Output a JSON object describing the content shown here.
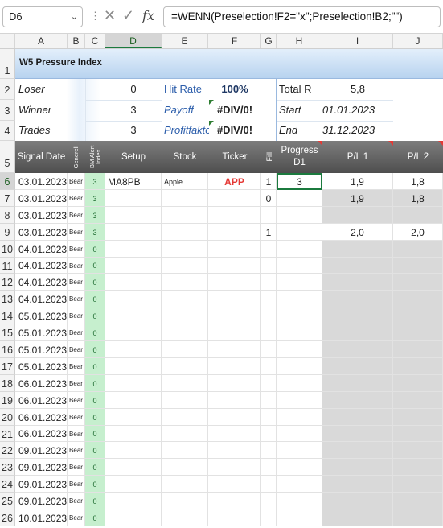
{
  "formula_bar": {
    "name_box": "D6",
    "cancel_icon": "✕",
    "enter_icon": "✓",
    "fx_label": "fx",
    "formula": "=WENN(Preselection!F2=\"x\";Preselection!B2;\"\")"
  },
  "columns": [
    "A",
    "B",
    "C",
    "D",
    "E",
    "F",
    "G",
    "H",
    "I",
    "J"
  ],
  "title": "W5 Pressure Index",
  "stats": {
    "loser_label": "Loser",
    "loser_value": "0",
    "winner_label": "Winner",
    "winner_value": "3",
    "trades_label": "Trades",
    "trades_value": "3",
    "hitrate_label": "Hit Rate",
    "hitrate_value": "100%",
    "payoff_label": "Payoff",
    "payoff_value": "#DIV/0!",
    "profit_label": "Profitfaktor",
    "profit_value": "#DIV/0!",
    "totalr_label": "Total R",
    "totalr_value": "5,8",
    "start_label": "Start",
    "start_value": "01.01.2023",
    "end_label": "End",
    "end_value": "31.12.2023"
  },
  "table_headers": {
    "signal_date": "Signal Date",
    "generell": "Generell",
    "bm_alert": "BM Alert Index",
    "setup": "Setup",
    "stock": "Stock",
    "ticker": "Ticker",
    "fill": "Fill",
    "progress": "Progress D1",
    "pl1": "P/L 1",
    "pl2": "P/L 2"
  },
  "rows": [
    {
      "rn": "6",
      "date": "03.01.2023",
      "gen": "Bear",
      "bm": "3",
      "setup": "MA8PB",
      "stock": "Apple",
      "ticker": "APP",
      "fill": "1",
      "progress": "3",
      "pl1": "1,9",
      "pl2": "1,8"
    },
    {
      "rn": "7",
      "date": "03.01.2023",
      "gen": "Bear",
      "bm": "3",
      "setup": "",
      "stock": "",
      "ticker": "",
      "fill": "0",
      "progress": "",
      "pl1": "1,9",
      "pl2": "1,8"
    },
    {
      "rn": "8",
      "date": "03.01.2023",
      "gen": "Bear",
      "bm": "3",
      "setup": "",
      "stock": "",
      "ticker": "",
      "fill": "",
      "progress": "",
      "pl1": "",
      "pl2": ""
    },
    {
      "rn": "9",
      "date": "03.01.2023",
      "gen": "Bear",
      "bm": "3",
      "setup": "",
      "stock": "",
      "ticker": "",
      "fill": "1",
      "progress": "",
      "pl1": "2,0",
      "pl2": "2,0"
    },
    {
      "rn": "10",
      "date": "04.01.2023",
      "gen": "Bear",
      "bm": "0",
      "setup": "",
      "stock": "",
      "ticker": "",
      "fill": "",
      "progress": "",
      "pl1": "",
      "pl2": ""
    },
    {
      "rn": "11",
      "date": "04.01.2023",
      "gen": "Bear",
      "bm": "0",
      "setup": "",
      "stock": "",
      "ticker": "",
      "fill": "",
      "progress": "",
      "pl1": "",
      "pl2": ""
    },
    {
      "rn": "12",
      "date": "04.01.2023",
      "gen": "Bear",
      "bm": "0",
      "setup": "",
      "stock": "",
      "ticker": "",
      "fill": "",
      "progress": "",
      "pl1": "",
      "pl2": ""
    },
    {
      "rn": "13",
      "date": "04.01.2023",
      "gen": "Bear",
      "bm": "0",
      "setup": "",
      "stock": "",
      "ticker": "",
      "fill": "",
      "progress": "",
      "pl1": "",
      "pl2": ""
    },
    {
      "rn": "14",
      "date": "05.01.2023",
      "gen": "Bear",
      "bm": "0",
      "setup": "",
      "stock": "",
      "ticker": "",
      "fill": "",
      "progress": "",
      "pl1": "",
      "pl2": ""
    },
    {
      "rn": "15",
      "date": "05.01.2023",
      "gen": "Bear",
      "bm": "0",
      "setup": "",
      "stock": "",
      "ticker": "",
      "fill": "",
      "progress": "",
      "pl1": "",
      "pl2": ""
    },
    {
      "rn": "16",
      "date": "05.01.2023",
      "gen": "Bear",
      "bm": "0",
      "setup": "",
      "stock": "",
      "ticker": "",
      "fill": "",
      "progress": "",
      "pl1": "",
      "pl2": ""
    },
    {
      "rn": "17",
      "date": "05.01.2023",
      "gen": "Bear",
      "bm": "0",
      "setup": "",
      "stock": "",
      "ticker": "",
      "fill": "",
      "progress": "",
      "pl1": "",
      "pl2": ""
    },
    {
      "rn": "18",
      "date": "06.01.2023",
      "gen": "Bear",
      "bm": "0",
      "setup": "",
      "stock": "",
      "ticker": "",
      "fill": "",
      "progress": "",
      "pl1": "",
      "pl2": ""
    },
    {
      "rn": "19",
      "date": "06.01.2023",
      "gen": "Bear",
      "bm": "0",
      "setup": "",
      "stock": "",
      "ticker": "",
      "fill": "",
      "progress": "",
      "pl1": "",
      "pl2": ""
    },
    {
      "rn": "20",
      "date": "06.01.2023",
      "gen": "Bear",
      "bm": "0",
      "setup": "",
      "stock": "",
      "ticker": "",
      "fill": "",
      "progress": "",
      "pl1": "",
      "pl2": ""
    },
    {
      "rn": "21",
      "date": "06.01.2023",
      "gen": "Bear",
      "bm": "0",
      "setup": "",
      "stock": "",
      "ticker": "",
      "fill": "",
      "progress": "",
      "pl1": "",
      "pl2": ""
    },
    {
      "rn": "22",
      "date": "09.01.2023",
      "gen": "Bear",
      "bm": "0",
      "setup": "",
      "stock": "",
      "ticker": "",
      "fill": "",
      "progress": "",
      "pl1": "",
      "pl2": ""
    },
    {
      "rn": "23",
      "date": "09.01.2023",
      "gen": "Bear",
      "bm": "0",
      "setup": "",
      "stock": "",
      "ticker": "",
      "fill": "",
      "progress": "",
      "pl1": "",
      "pl2": ""
    },
    {
      "rn": "24",
      "date": "09.01.2023",
      "gen": "Bear",
      "bm": "0",
      "setup": "",
      "stock": "",
      "ticker": "",
      "fill": "",
      "progress": "",
      "pl1": "",
      "pl2": ""
    },
    {
      "rn": "25",
      "date": "09.01.2023",
      "gen": "Bear",
      "bm": "0",
      "setup": "",
      "stock": "",
      "ticker": "",
      "fill": "",
      "progress": "",
      "pl1": "",
      "pl2": ""
    },
    {
      "rn": "26",
      "date": "10.01.2023",
      "gen": "Bear",
      "bm": "0",
      "setup": "",
      "stock": "",
      "ticker": "",
      "fill": "",
      "progress": "",
      "pl1": "",
      "pl2": ""
    }
  ],
  "colors": {
    "bm_green": "#c6efce",
    "ticker_red": "#e53935",
    "selection": "#1b7a3e",
    "gray_fill": "#d9d9d9"
  }
}
